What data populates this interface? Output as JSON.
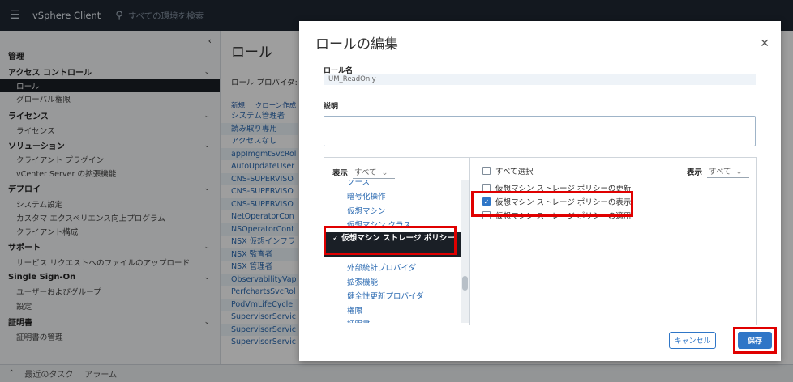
{
  "topbar": {
    "app_title": "vSphere Client",
    "search_placeholder": "すべての環境を検索"
  },
  "nav": {
    "collapse_icon": "chevron-left-icon",
    "rows": [
      {
        "label": "管理",
        "type": "section"
      },
      {
        "label": "アクセス コントロール",
        "type": "section",
        "chevron": "⌄"
      },
      {
        "label": "ロール",
        "type": "item",
        "selected": true
      },
      {
        "label": "グローバル権限",
        "type": "item"
      },
      {
        "label": "ライセンス",
        "type": "section",
        "chevron": "⌄"
      },
      {
        "label": "ライセンス",
        "type": "item"
      },
      {
        "label": "ソリューション",
        "type": "section",
        "chevron": "⌄"
      },
      {
        "label": "クライアント プラグイン",
        "type": "item"
      },
      {
        "label": "vCenter Server の拡張機能",
        "type": "item"
      },
      {
        "label": "デプロイ",
        "type": "section",
        "chevron": "⌄"
      },
      {
        "label": "システム設定",
        "type": "item"
      },
      {
        "label": "カスタマ エクスペリエンス向上プログラム",
        "type": "item"
      },
      {
        "label": "クライアント構成",
        "type": "item"
      },
      {
        "label": "サポート",
        "type": "section",
        "chevron": "⌄"
      },
      {
        "label": "サービス リクエストへのファイルのアップロード",
        "type": "item"
      },
      {
        "label": "Single Sign-On",
        "type": "section",
        "chevron": "⌄"
      },
      {
        "label": "ユーザーおよびグループ",
        "type": "item"
      },
      {
        "label": "設定",
        "type": "item"
      },
      {
        "label": "証明書",
        "type": "section",
        "chevron": "⌄"
      },
      {
        "label": "証明書の管理",
        "type": "item"
      }
    ]
  },
  "bottombar": {
    "recent_tasks": "最近のタスク",
    "alarms": "アラーム"
  },
  "main": {
    "title": "ロール",
    "provider_label": "ロール プロバイダ:",
    "actions": [
      "新規",
      "クローン作成"
    ],
    "roles": [
      "システム管理者",
      "読み取り専用",
      "アクセスなし",
      "appImgmtSvcRol",
      "AutoUpdateUser",
      "CNS-SUPERVISO",
      "CNS-SUPERVISO",
      "CNS-SUPERVISO",
      "NetOperatorCon",
      "NSOperatorCont",
      "NSX 仮想インフラ",
      "NSX 監査者",
      "NSX 管理者",
      "ObservabilityVap",
      "PerfchartsSvcRol",
      "PodVmLifeCycle",
      "SupervisorServic",
      "SupervisorServic",
      "SupervisorServic"
    ]
  },
  "modal": {
    "title": "ロールの編集",
    "close_icon": "close-icon",
    "role_name_label": "ロール名",
    "role_name_value": "UM_ReadOnly",
    "description_label": "説明",
    "left_pane": {
      "view_label": "表示",
      "view_value": "すべて",
      "privileges": [
        "ソース",
        "暗号化操作",
        "仮想マシン",
        "仮想マシン クラス",
        "仮想マシン ストレージ ポリシー",
        "外部統計プロバイダ",
        "拡張機能",
        "健全性更新プロバイダ",
        "権限",
        "証明書"
      ],
      "selected_index": 4
    },
    "right_pane": {
      "select_all_label": "すべて選択",
      "view_label": "表示",
      "view_value": "すべて",
      "privileges": [
        {
          "label": "仮想マシン ストレージ ポリシーの更新",
          "checked": false
        },
        {
          "label": "仮想マシン ストレージ ポリシーの表示",
          "checked": true
        },
        {
          "label": "仮想マシン ストレージ ポリシーの適用",
          "checked": false
        }
      ]
    },
    "cancel_label": "キャンセル",
    "save_label": "保存"
  },
  "colors": {
    "accent": "#2f76c7",
    "highlight": "#e00000",
    "topbar": "#1f2733"
  }
}
